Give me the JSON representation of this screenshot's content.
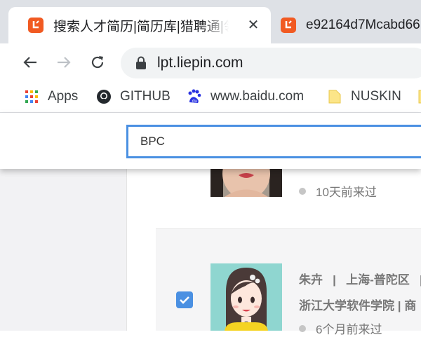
{
  "tabs": [
    {
      "title": "搜索人才简历|简历库|猎聘通|领先",
      "favicon": "liepin-logo-icon",
      "close": "✕"
    },
    {
      "title": "e92164d7Mcabd66",
      "favicon": "liepin-logo-icon"
    }
  ],
  "toolbar": {
    "url": "lpt.liepin.com"
  },
  "bookmarks": [
    {
      "label": "Apps",
      "icon": "apps-grid-icon"
    },
    {
      "label": "GITHUB",
      "icon": "github-icon"
    },
    {
      "label": "www.baidu.com",
      "icon": "baidu-icon"
    },
    {
      "label": "NUSKIN",
      "icon": "folder-icon"
    }
  ],
  "search": {
    "value": "BPC"
  },
  "candidates": [
    {
      "last_visit": "10天前来过"
    },
    {
      "name": "朱卉",
      "sep": "|",
      "location": "上海-普陀区",
      "school": "浙江大学软件学院 | 商",
      "last_visit": "6个月前来过",
      "selected": true
    }
  ],
  "colors": {
    "accent": "#4a90e2",
    "brand": "#f15a22"
  }
}
